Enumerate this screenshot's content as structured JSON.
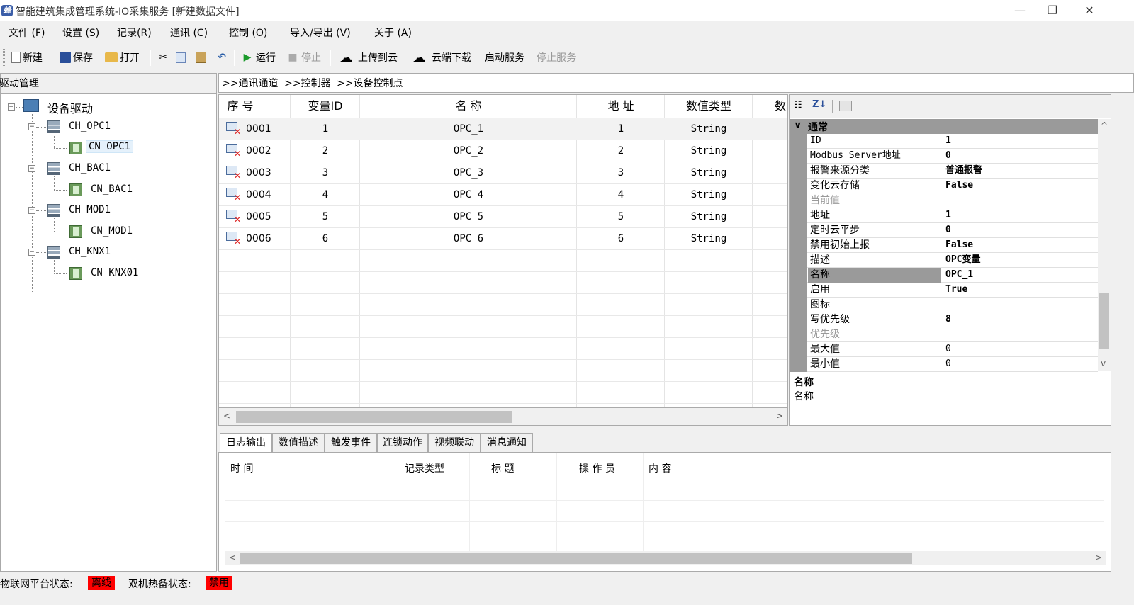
{
  "window": {
    "title": "智能建筑集成管理系统-IO采集服务 [新建数据文件]",
    "app_icon": "蜂",
    "minimize": "—",
    "restore": "❐",
    "close": "✕"
  },
  "menu": {
    "items": [
      "文件 (F)",
      "设置 (S)",
      "记录(R)",
      "通讯 (C)",
      "控制 (O)",
      "导入/导出 (V)",
      "关于 (A)"
    ]
  },
  "toolbar": {
    "new": "新建",
    "save": "保存",
    "open": "打开",
    "run": "运行",
    "stop": "停止",
    "upload": "上传到云",
    "download": "云端下载",
    "start_service": "启动服务",
    "stop_service": "停止服务"
  },
  "tree": {
    "header": "驱动管理",
    "root": "设备驱动",
    "channels": [
      {
        "name": "CH_OPC1",
        "child": "CN_OPC1"
      },
      {
        "name": "CH_BAC1",
        "child": "CN_BAC1"
      },
      {
        "name": "CH_MOD1",
        "child": "CN_MOD1"
      },
      {
        "name": "CH_KNX1",
        "child": "CN_KNX01"
      }
    ]
  },
  "breadcrumb": [
    ">>通讯通道",
    ">>控制器",
    ">>设备控制点"
  ],
  "grid": {
    "headers": [
      "序  号",
      "变量ID",
      "名  称",
      "地  址",
      "数值类型",
      "数"
    ],
    "rows": [
      {
        "seq": "0001",
        "id": "1",
        "name": "OPC_1",
        "addr": "1",
        "type": "String"
      },
      {
        "seq": "0002",
        "id": "2",
        "name": "OPC_2",
        "addr": "2",
        "type": "String"
      },
      {
        "seq": "0003",
        "id": "3",
        "name": "OPC_3",
        "addr": "3",
        "type": "String"
      },
      {
        "seq": "0004",
        "id": "4",
        "name": "OPC_4",
        "addr": "4",
        "type": "String"
      },
      {
        "seq": "0005",
        "id": "5",
        "name": "OPC_5",
        "addr": "5",
        "type": "String"
      },
      {
        "seq": "0006",
        "id": "6",
        "name": "OPC_6",
        "addr": "6",
        "type": "String"
      }
    ]
  },
  "properties": {
    "category": "通常",
    "category_toggle": "∨",
    "rows": [
      {
        "name": "ID",
        "value": "1"
      },
      {
        "name": "Modbus Server地址",
        "value": "0"
      },
      {
        "name": "报警来源分类",
        "value": "普通报警"
      },
      {
        "name": "变化云存储",
        "value": "False"
      },
      {
        "name": "当前值",
        "value": ""
      },
      {
        "name": "地址",
        "value": "1"
      },
      {
        "name": "定时云平步",
        "value": "0"
      },
      {
        "name": "禁用初始上报",
        "value": "False"
      },
      {
        "name": "描述",
        "value": "OPC变量"
      },
      {
        "name": "名称",
        "value": "OPC_1"
      },
      {
        "name": "启用",
        "value": "True"
      },
      {
        "name": "图标",
        "value": ""
      },
      {
        "name": "写优先级",
        "value": "8"
      },
      {
        "name": "优先级",
        "value": ""
      },
      {
        "name": "最大值",
        "value": "0"
      },
      {
        "name": "最小值",
        "value": "0"
      }
    ],
    "description_title": "名称",
    "description_text": "名称"
  },
  "bottom_tabs": [
    "日志输出",
    "数值描述",
    "触发事件",
    "连锁动作",
    "视频联动",
    "消息通知"
  ],
  "log": {
    "headers": [
      "时   间",
      "记录类型",
      "标    题",
      "操 作 员",
      "内    容"
    ]
  },
  "status": {
    "iot_label": "物联网平台状态:",
    "iot_value": "离线",
    "iot_color": "#ff0000",
    "hotbackup_label": "双机热备状态:",
    "hotbackup_value": "禁用",
    "hotbackup_color": "#ff0000"
  }
}
